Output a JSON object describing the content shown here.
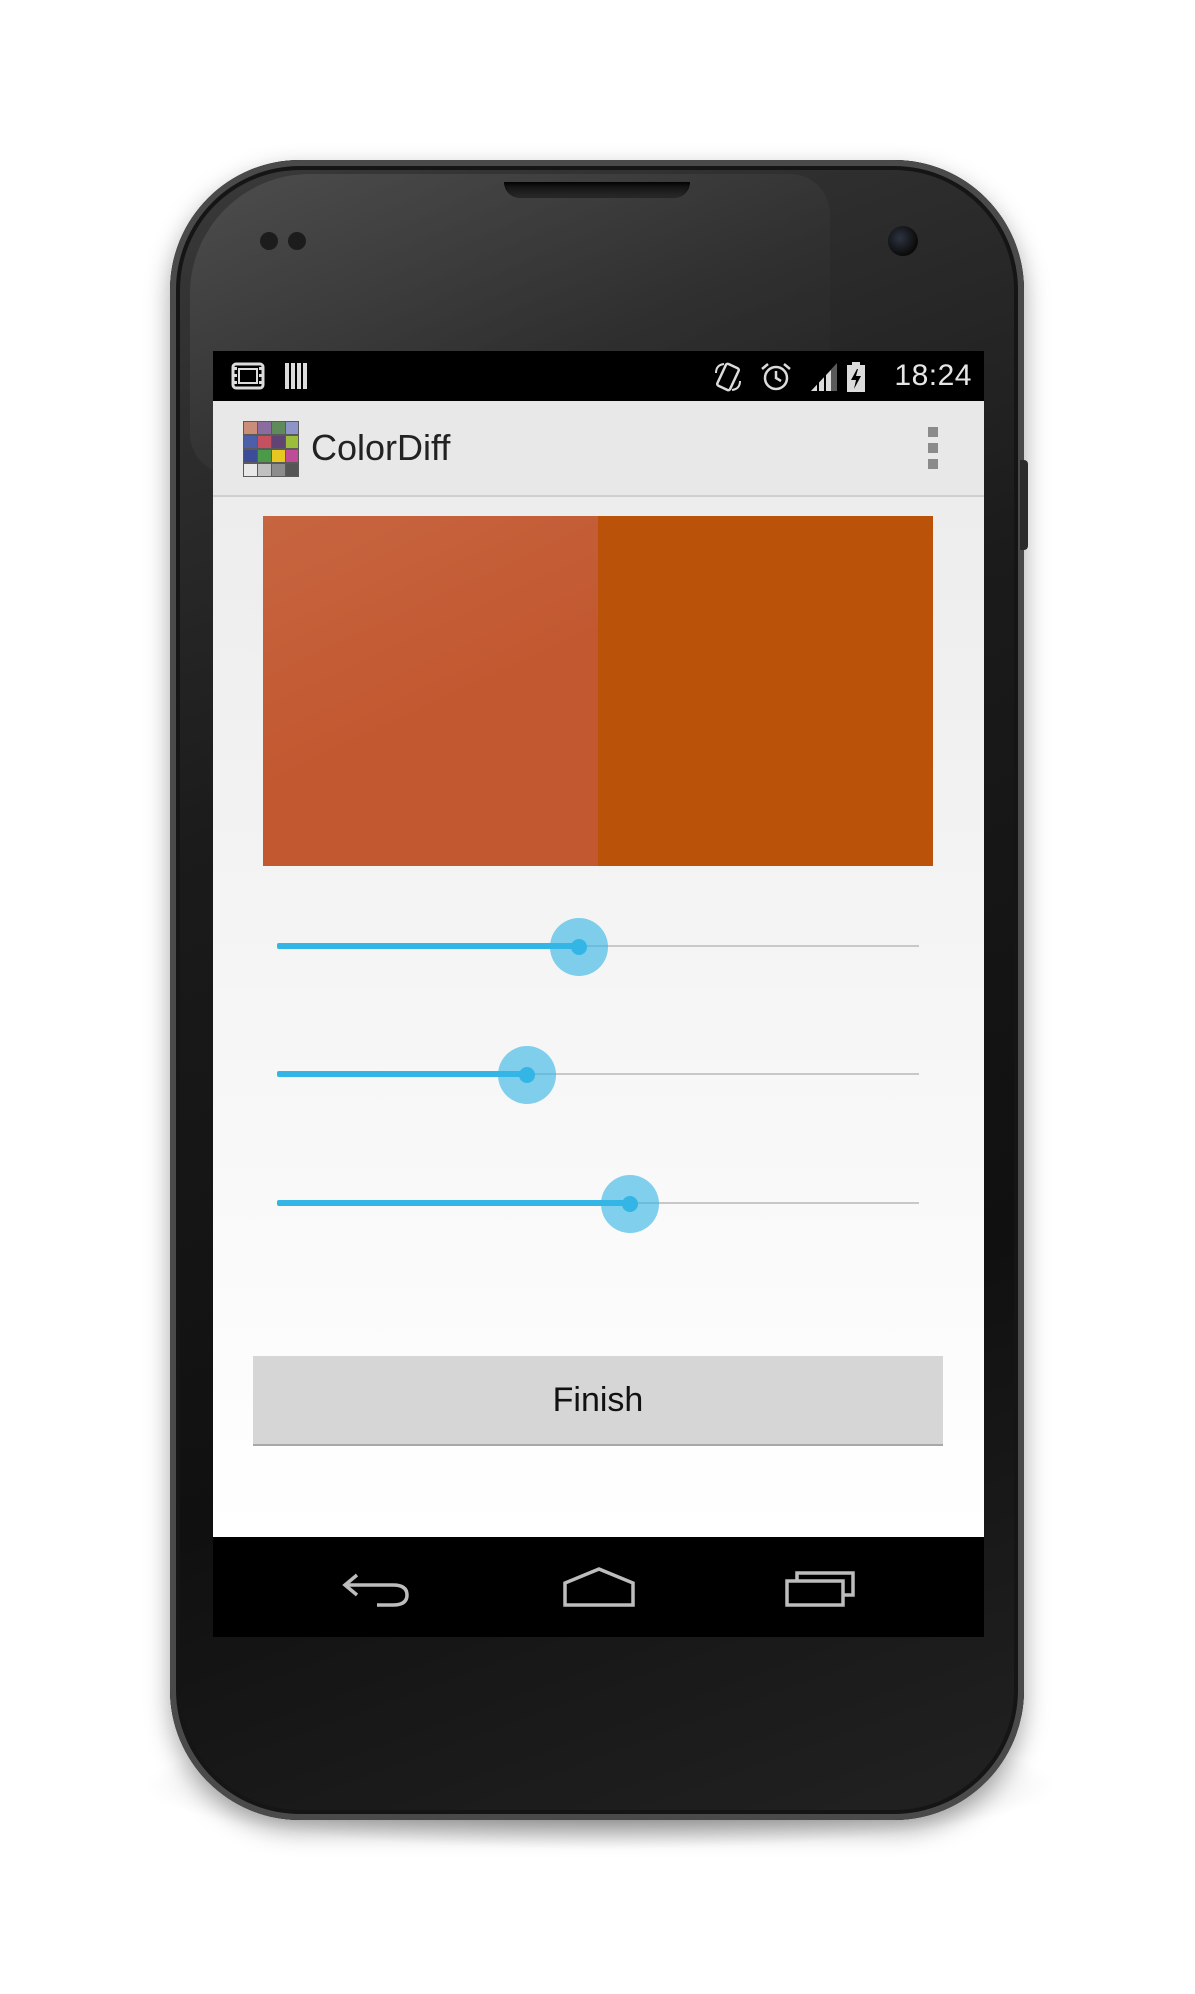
{
  "status_bar": {
    "time": "18:24",
    "left_icons": [
      "film-notification-icon",
      "storage-notification-icon"
    ],
    "right_icons": [
      "auto-rotate-icon",
      "alarm-icon",
      "signal-icon",
      "battery-charging-icon"
    ]
  },
  "action_bar": {
    "app_name": "ColorDiff",
    "app_icon": "color-checker-grid-icon",
    "overflow_icon": "overflow-menu-icon"
  },
  "swatches": {
    "reference_color": "#c25830",
    "match_color": "#bb520a"
  },
  "sliders": [
    {
      "name": "slider-1",
      "value": 0.47
    },
    {
      "name": "slider-2",
      "value": 0.39
    },
    {
      "name": "slider-3",
      "value": 0.55
    }
  ],
  "finish_button": {
    "label": "Finish"
  },
  "navigation": {
    "back_icon": "back-icon",
    "home_icon": "home-icon",
    "recents_icon": "recents-icon"
  },
  "colors": {
    "accent": "#33b5e5",
    "action_bar_bg": "#e8e8e8",
    "button_bg": "#d6d6d6"
  }
}
